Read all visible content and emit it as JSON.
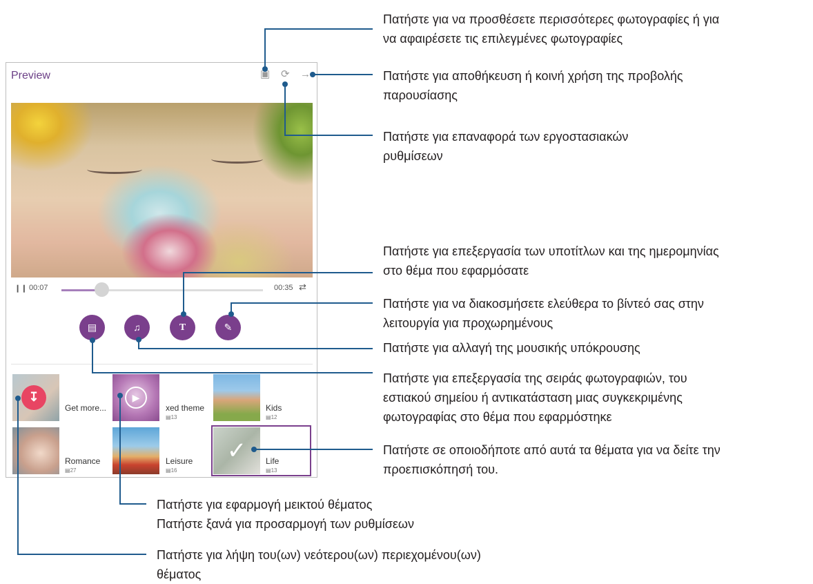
{
  "screen": {
    "title": "Preview",
    "top_icons": {
      "add_photos": "add-photos-icon",
      "reset": "reset-icon",
      "next": "arrow-right-icon"
    },
    "player": {
      "elapsed": "00:07",
      "duration": "00:35",
      "progress": 0.2
    },
    "action_buttons": [
      {
        "name": "photos",
        "icon": "image-icon"
      },
      {
        "name": "music",
        "icon": "music-note-icon"
      },
      {
        "name": "text",
        "icon": "text-icon"
      },
      {
        "name": "edit",
        "icon": "edit-video-icon"
      }
    ],
    "themes": [
      {
        "label": "Get more...",
        "count": ""
      },
      {
        "label": "xed theme",
        "count": "13"
      },
      {
        "label": "Kids",
        "count": "12"
      },
      {
        "label": "Romance",
        "count": "27"
      },
      {
        "label": "Leisure",
        "count": "16"
      },
      {
        "label": "Life",
        "count": "13"
      }
    ],
    "accent_color": "#7a3f8c"
  },
  "annotations": {
    "add_photos": [
      "Πατήστε για να προσθέσετε περισσότερες φωτογραφίες ή για",
      "να αφαιρέσετε τις επιλεγμένες φωτογραφίες"
    ],
    "save_share": [
      "Πατήστε για αποθήκευση ή κοινή χρήση της προβολής",
      "παρουσίασης"
    ],
    "reset": [
      "Πατήστε για επαναφορά των εργοστασιακών",
      "ρυθμίσεων"
    ],
    "text": [
      "Πατήστε για επεξεργασία των υποτίτλων και της ημερομηνίας",
      "στο θέμα που εφαρμόσατε"
    ],
    "edit": [
      "Πατήστε για να διακοσμήσετε ελεύθερα το βίντεό σας στην",
      "λειτουργία για προχωρημένους"
    ],
    "music": [
      "Πατήστε για αλλαγή της μουσικής υπόκρουσης"
    ],
    "photos": [
      "Πατήστε για επεξεργασία της σειράς φωτογραφιών, του",
      "εστιακού σημείου ή αντικατάσταση μιας συγκεκριμένης",
      "φωτογραφίας στο θέμα που εφαρμόστηκε"
    ],
    "themes": [
      "Πατήστε σε οποιοδήποτε από αυτά τα θέματα για να δείτε την",
      "προεπισκόπησή του."
    ],
    "mixed": [
      "Πατήστε για εφαρμογή μεικτού θέματος",
      "Πατήστε ξανά για προσαρμογή των ρυθμίσεων"
    ],
    "download": [
      "Πατήστε για λήψη του(ων) νεότερου(ων) περιεχομένου(ων)",
      "θέματος"
    ]
  }
}
